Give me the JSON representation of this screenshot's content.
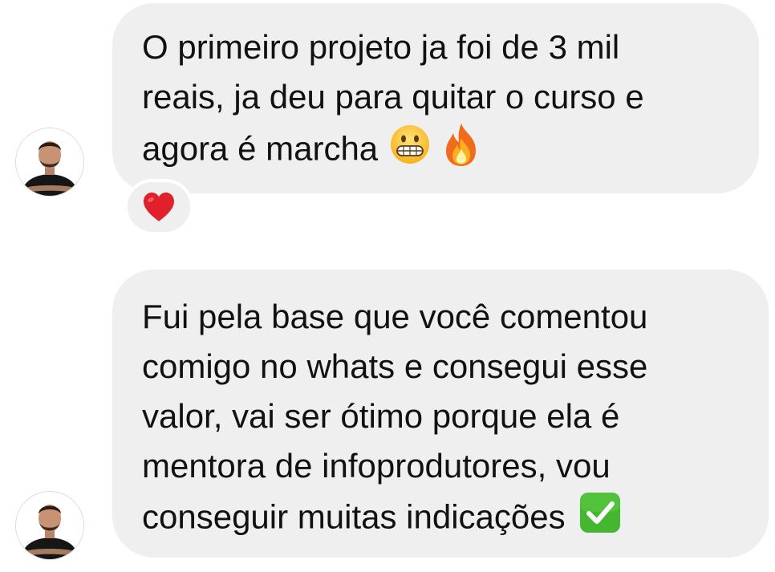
{
  "thread": {
    "messages": [
      {
        "lines": [
          "O primeiro projeto ja foi de 3 mil",
          "reais, ja deu para quitar o curso e",
          "agora é marcha"
        ],
        "emojis": [
          "grimacing-face-emoji",
          "fire-emoji"
        ],
        "reaction": "red-heart-emoji"
      },
      {
        "lines": [
          "Fui pela base que você comentou",
          "comigo no whats e consegui esse",
          "valor, vai ser ótimo porque ela é",
          "mentora de infoprodutores, vou",
          "conseguir muitas indicações"
        ],
        "emojis": [
          "check-mark-button-emoji"
        ]
      }
    ]
  },
  "colors": {
    "bubble": "#efefef",
    "text": "#111111",
    "heart": "#e0202a",
    "check": "#44b62f",
    "fire": "#f58220"
  }
}
